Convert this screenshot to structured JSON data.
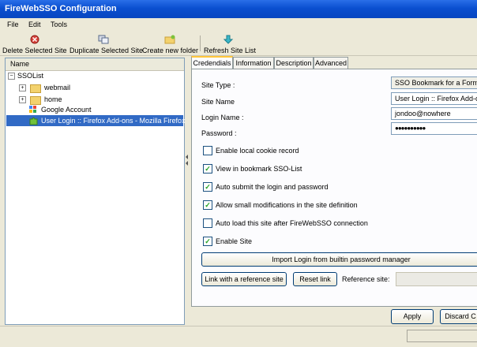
{
  "window": {
    "title": "FireWebSSO Configuration"
  },
  "menu": {
    "file": "File",
    "edit": "Edit",
    "tools": "Tools"
  },
  "toolbar": {
    "delete": "Delete Selected Site",
    "duplicate": "Duplicate Selected Site",
    "create_folder": "Create new folder",
    "refresh": "Refresh Site List"
  },
  "tree": {
    "header": "Name",
    "root": "SSOList",
    "webmail": "webmail",
    "home": "home",
    "google": "Google Account",
    "selected": "User Login :: Firefox Add-ons - Mozilla Firefox"
  },
  "tabs": {
    "credentials": "Credendials",
    "information": "Information",
    "description": "Description",
    "advanced": "Advanced"
  },
  "form": {
    "site_type_label": "Site Type :",
    "site_type_value": "SSO Bookmark for a Form",
    "site_name_label": "Site Name",
    "site_name_value": "User Login :: Firefox Add-o",
    "login_label": "Login Name :",
    "login_value": "jondoo@nowhere",
    "password_label": "Password :",
    "password_value": "●●●●●●●●●●"
  },
  "options": {
    "local_cookie": {
      "label": "Enable local cookie record",
      "checked": false
    },
    "view_bookmark": {
      "label": "View in bookmark SSO-List",
      "checked": true
    },
    "auto_submit": {
      "label": "Auto submit the login and password",
      "checked": true
    },
    "small_mods": {
      "label": "Allow small modifications in the site definition",
      "checked": true
    },
    "auto_load": {
      "label": "Auto load this site after FireWebSSO connection",
      "checked": false
    },
    "enable_site": {
      "label": "Enable Site",
      "checked": true
    }
  },
  "buttons": {
    "import": "Import Login from builtin password manager",
    "link_ref": "Link with a reference site",
    "reset_link": "Reset link",
    "reference_label": "Reference site:",
    "apply": "Apply",
    "discard": "Discard C"
  },
  "colors": {
    "title": "#0a4fd0",
    "selection": "#316ac5",
    "check": "#21a121"
  }
}
